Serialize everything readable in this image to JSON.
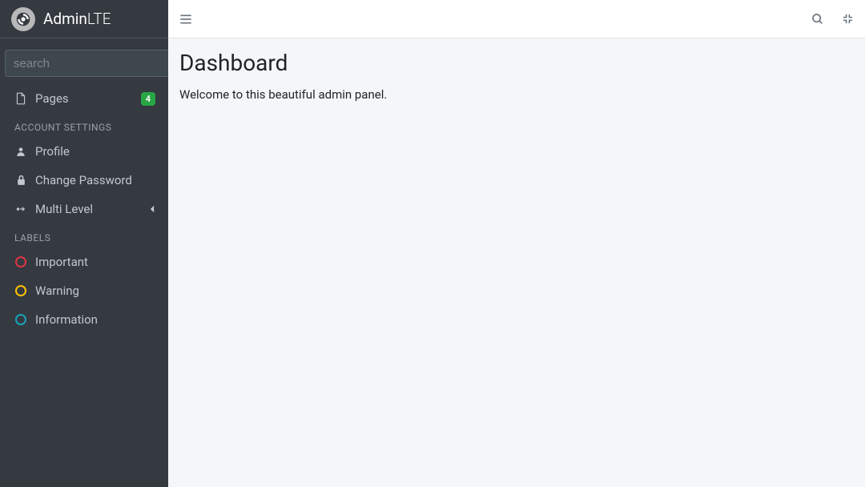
{
  "brand": {
    "name_bold": "Admin",
    "name_light": "LTE"
  },
  "search": {
    "placeholder": "search"
  },
  "nav": {
    "pages": {
      "label": "Pages",
      "badge": "4"
    },
    "headers": {
      "account": "ACCOUNT SETTINGS",
      "labels": "LABELS"
    },
    "profile": {
      "label": "Profile"
    },
    "change_password": {
      "label": "Change Password"
    },
    "multi_level": {
      "label": "Multi Level"
    },
    "important": {
      "label": "Important"
    },
    "warning": {
      "label": "Warning"
    },
    "information": {
      "label": "Information"
    }
  },
  "content": {
    "title": "Dashboard",
    "welcome": "Welcome to this beautiful admin panel."
  }
}
